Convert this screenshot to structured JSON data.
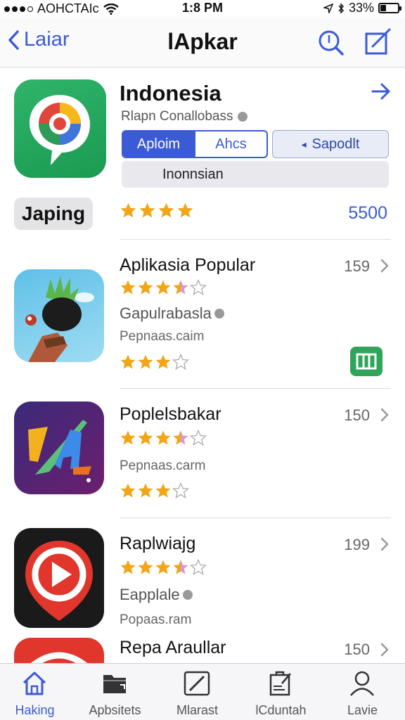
{
  "status": {
    "carrier": "AOHCTAIc",
    "time": "1:8 PM",
    "battery_text": "33%",
    "battery_level": 0.33
  },
  "nav": {
    "back_label": "Laiar",
    "title": "lApkar"
  },
  "featured": {
    "title": "Indonesia",
    "subtitle": "Rlapn Conallobass",
    "segment_left": "Aploim",
    "segment_right": "Ahcs",
    "button_label": "Sapodlt",
    "input_value": "Inonnsian",
    "chip_label": "Japing",
    "count": "5500",
    "rating": 4
  },
  "apps": [
    {
      "title": "Aplikasia Popular",
      "count": "159",
      "line1": "Gapulrabasla",
      "line2": "Pepnaas.caim",
      "rating_top": 3.5,
      "rating_bottom": 3
    },
    {
      "title": "Poplelsbakar",
      "count": "150",
      "line2": "Pepnaas.carm",
      "rating_top": 3.5,
      "rating_bottom": 3
    },
    {
      "title": "Raplwiajg",
      "count": "199",
      "line1": "Eapplale",
      "line2": "Popaas.ram",
      "rating_top": 3.5
    },
    {
      "title": "Repa Araullar",
      "count": "150"
    }
  ],
  "tabs": [
    {
      "label": "Haking",
      "icon": "home-icon"
    },
    {
      "label": "Apbsitets",
      "icon": "folder-icon"
    },
    {
      "label": "Mlarast",
      "icon": "pen-icon"
    },
    {
      "label": "lCduntah",
      "icon": "clipboard-icon"
    },
    {
      "label": "Lavie",
      "icon": "person-icon"
    }
  ],
  "colors": {
    "accent": "#3b5bd6",
    "star": "#f2a516",
    "star_pink": "#d89ad0",
    "green": "#2ea55a"
  }
}
